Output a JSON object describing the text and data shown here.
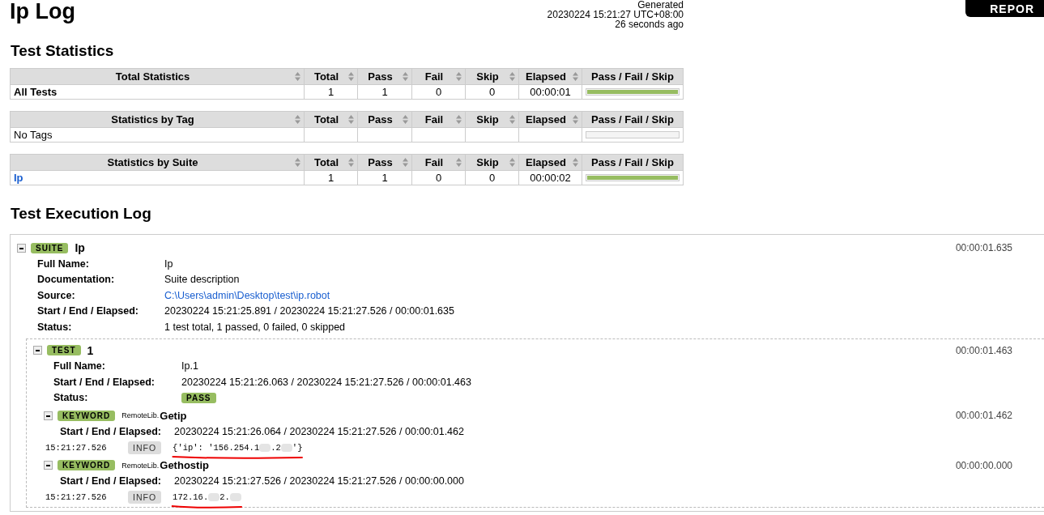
{
  "header": {
    "title": "Ip Log",
    "generated": [
      "Generated",
      "20230224 15:21:27 UTC+08:00",
      "26 seconds ago"
    ],
    "report_button": "REPOR"
  },
  "statistics": {
    "title": "Test Statistics",
    "tables": [
      {
        "columns": [
          "Total Statistics",
          "Total",
          "Pass",
          "Fail",
          "Skip",
          "Elapsed",
          "Pass / Fail / Skip"
        ],
        "rows": [
          {
            "kind": "bold",
            "name": "All Tests",
            "total": "1",
            "pass": "1",
            "fail": "0",
            "skip": "0",
            "elapsed": "00:00:01",
            "level": 1
          }
        ]
      },
      {
        "columns": [
          "Statistics by Tag",
          "Total",
          "Pass",
          "Fail",
          "Skip",
          "Elapsed",
          "Pass / Fail / Skip"
        ],
        "rows": [
          {
            "kind": "plain",
            "name": "No Tags"
          }
        ]
      },
      {
        "columns": [
          "Statistics by Suite",
          "Total",
          "Pass",
          "Fail",
          "Skip",
          "Elapsed",
          "Pass / Fail / Skip"
        ],
        "rows": [
          {
            "kind": "link",
            "name": "Ip",
            "total": "1",
            "pass": "1",
            "fail": "0",
            "skip": "0",
            "elapsed": "00:00:02",
            "level": 1
          }
        ]
      }
    ]
  },
  "log": {
    "title": "Test Execution Log",
    "suite": {
      "kind": "suite",
      "badge": "SUITE",
      "name": "Ip",
      "elapsed": "00:00:01.635",
      "expanded": true,
      "meta": [
        {
          "label": "Full Name:",
          "kind": "text",
          "value": "Ip"
        },
        {
          "label": "Documentation:",
          "kind": "text",
          "value": "Suite description"
        },
        {
          "label": "Source:",
          "kind": "link",
          "value": "C:\\Users\\admin\\Desktop\\test\\ip.robot"
        },
        {
          "label": "Start / End / Elapsed:",
          "kind": "text",
          "value": "20230224 15:21:25.891 / 20230224 15:21:27.526 / 00:00:01.635"
        },
        {
          "label": "Status:",
          "kind": "text",
          "value": "1 test total, 1 passed, 0 failed, 0 skipped"
        }
      ],
      "children": [
        {
          "kind": "test",
          "badge": "TEST",
          "name": "1",
          "elapsed": "00:00:01.463",
          "expanded": true,
          "meta": [
            {
              "label": "Full Name:",
              "kind": "text",
              "value": "Ip.1"
            },
            {
              "label": "Start / End / Elapsed:",
              "kind": "text",
              "value": "20230224 15:21:26.063 / 20230224 15:21:27.526 / 00:00:01.463"
            },
            {
              "label": "Status:",
              "kind": "badge",
              "value": "PASS"
            }
          ],
          "children": [
            {
              "kind": "keyword",
              "badge": "KEYWORD",
              "library": "RemoteLib.",
              "name": "Getip",
              "elapsed": "00:00:01.462",
              "expanded": true,
              "meta": [
                {
                  "label": "Start / End / Elapsed:",
                  "kind": "text",
                  "value": "20230224 15:21:26.064 / 20230224 15:21:27.526 / 00:00:01.462"
                }
              ],
              "messages": [
                {
                  "time": "15:21:27.526",
                  "level": "INFO",
                  "underlined": true,
                  "segments": [
                    {
                      "kind": "text",
                      "text": "{'ip': '156.254.1"
                    },
                    {
                      "kind": "blur"
                    },
                    {
                      "kind": "text",
                      "text": ".2"
                    },
                    {
                      "kind": "blur"
                    },
                    {
                      "kind": "text",
                      "text": "'}"
                    }
                  ]
                }
              ]
            },
            {
              "kind": "keyword",
              "badge": "KEYWORD",
              "library": "RemoteLib.",
              "name": "Gethostip",
              "elapsed": "00:00:00.000",
              "expanded": true,
              "meta": [
                {
                  "label": "Start / End / Elapsed:",
                  "kind": "text",
                  "value": "20230224 15:21:27.526 / 20230224 15:21:27.526 / 00:00:00.000"
                }
              ],
              "messages": [
                {
                  "time": "15:21:27.526",
                  "level": "INFO",
                  "underlined": true,
                  "segments": [
                    {
                      "kind": "text",
                      "text": "172.16."
                    },
                    {
                      "kind": "blur"
                    },
                    {
                      "kind": "text",
                      "text": "2."
                    },
                    {
                      "kind": "blur"
                    }
                  ]
                }
              ]
            }
          ]
        }
      ]
    }
  }
}
